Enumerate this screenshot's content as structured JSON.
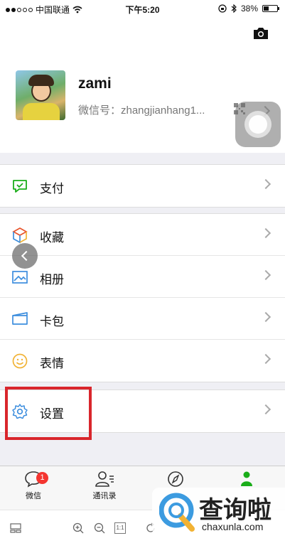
{
  "status_bar": {
    "carrier": "中国联通",
    "time": "下午5:20",
    "battery": "38%"
  },
  "profile": {
    "name": "zami",
    "wechat_id": "微信号：zhangjianhang1..."
  },
  "menu": {
    "pay": "支付",
    "favorites": "收藏",
    "album": "相册",
    "cards": "卡包",
    "stickers": "表情",
    "settings": "设置"
  },
  "tabbar": {
    "chats": "微信",
    "chats_badge": "1",
    "contacts": "通讯录"
  },
  "viewer": {
    "one_to_one": "1:1"
  },
  "watermark": {
    "title": "查询啦",
    "site": "chaxunla.com"
  },
  "colors": {
    "accent_green": "#1aad19",
    "highlight_red": "#d9262c",
    "badge_red": "#f43530"
  }
}
